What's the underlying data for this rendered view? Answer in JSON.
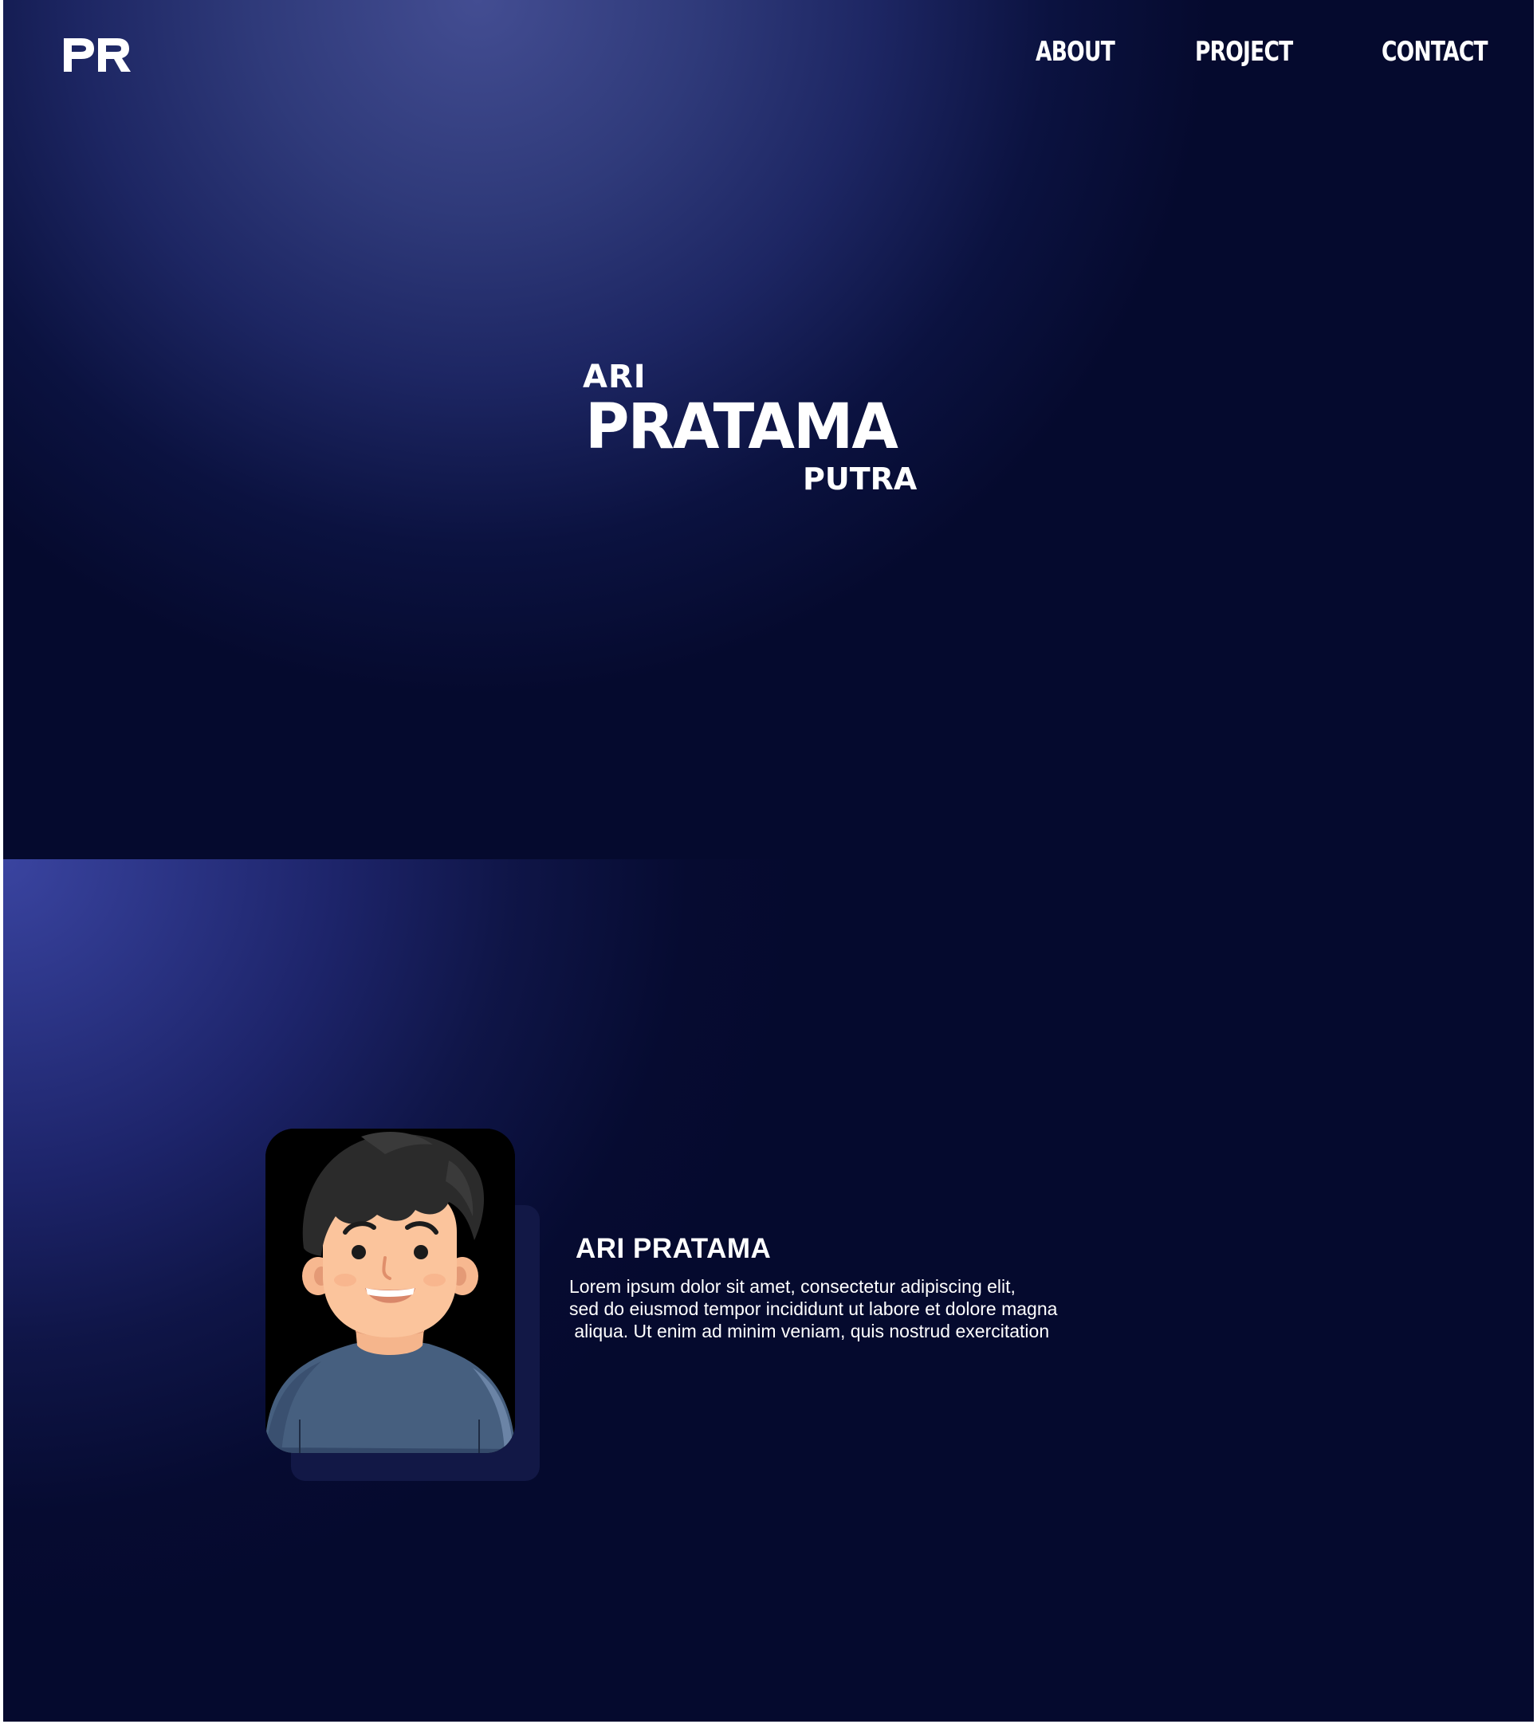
{
  "header": {
    "logo_text": "PR",
    "nav": {
      "about": "ABOUT",
      "project": "PROJECT",
      "contact": "CONTACT"
    }
  },
  "hero": {
    "first_name": "ARI",
    "middle_name": "PRATAMA",
    "last_name": "PUTRA"
  },
  "about": {
    "name": "ARI PRATAMA",
    "bio_lines": [
      "Lorem ipsum dolor sit amet, consectetur adipiscing elit,",
      "sed do eiusmod tempor incididunt ut labore et dolore magna",
      " aliqua. Ut enim ad minim veniam, quis nostrud exercitation"
    ],
    "avatar_icon": "person-avatar-illustration"
  },
  "colors": {
    "background_dark": "#050a2e",
    "hero_glow": "#434d92",
    "about_glow": "#3a44a0",
    "text": "#ffffff",
    "avatar_shadow": "#121846"
  }
}
